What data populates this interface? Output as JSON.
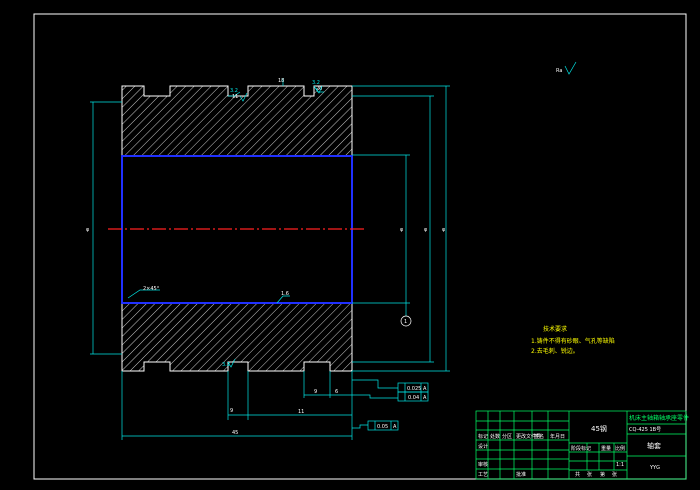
{
  "drawing": {
    "dimensions": {
      "top_groove_width": "11",
      "top_groove_right": "20",
      "top_center_mark": "18",
      "left_overall": "φ",
      "bore_diameter": "φ",
      "outer_diameter": "φ",
      "right_outer": "φ",
      "chamfer": "2×45°",
      "inner_note": "1.6",
      "bottom_left_dim": "9",
      "bottom_step_1": "9",
      "bottom_step_2": "6",
      "bottom_step_3": "9",
      "bottom_mid_length": "11",
      "bottom_total_length": "45",
      "datum_label": "A",
      "circle_marker": "1"
    },
    "surface_finish": {
      "general": "Ra",
      "top_left": "3.2",
      "top_right": "3.2",
      "bottom_left": "3.2"
    },
    "tolerance_frames": [
      {
        "value": "0.025",
        "datum": "A"
      },
      {
        "value": "0.04",
        "datum": "A"
      },
      {
        "value": "0.05",
        "datum": "A"
      }
    ],
    "technical_requirements": {
      "title": "技术要求",
      "items": [
        "1.铸件不得有砂眼、气孔等缺陷",
        "2.去毛刺、锐边。"
      ]
    },
    "title_block": {
      "material": "45钢",
      "project_title": "机床主轴箱轴承座零件",
      "drawing_number": "CQ-425 1B号",
      "part_name": "轴套",
      "school": "YYG",
      "row_labels": [
        "标记",
        "处数",
        "分区",
        "更改文件号",
        "签名",
        "年月日"
      ],
      "role_labels": [
        "设计",
        "审核",
        "工艺",
        "批准"
      ],
      "stage_labels": [
        "阶段标记",
        "重量",
        "比例"
      ],
      "scale": "1:1",
      "sheet_labels": [
        "共",
        "张",
        "第",
        "张"
      ]
    }
  }
}
